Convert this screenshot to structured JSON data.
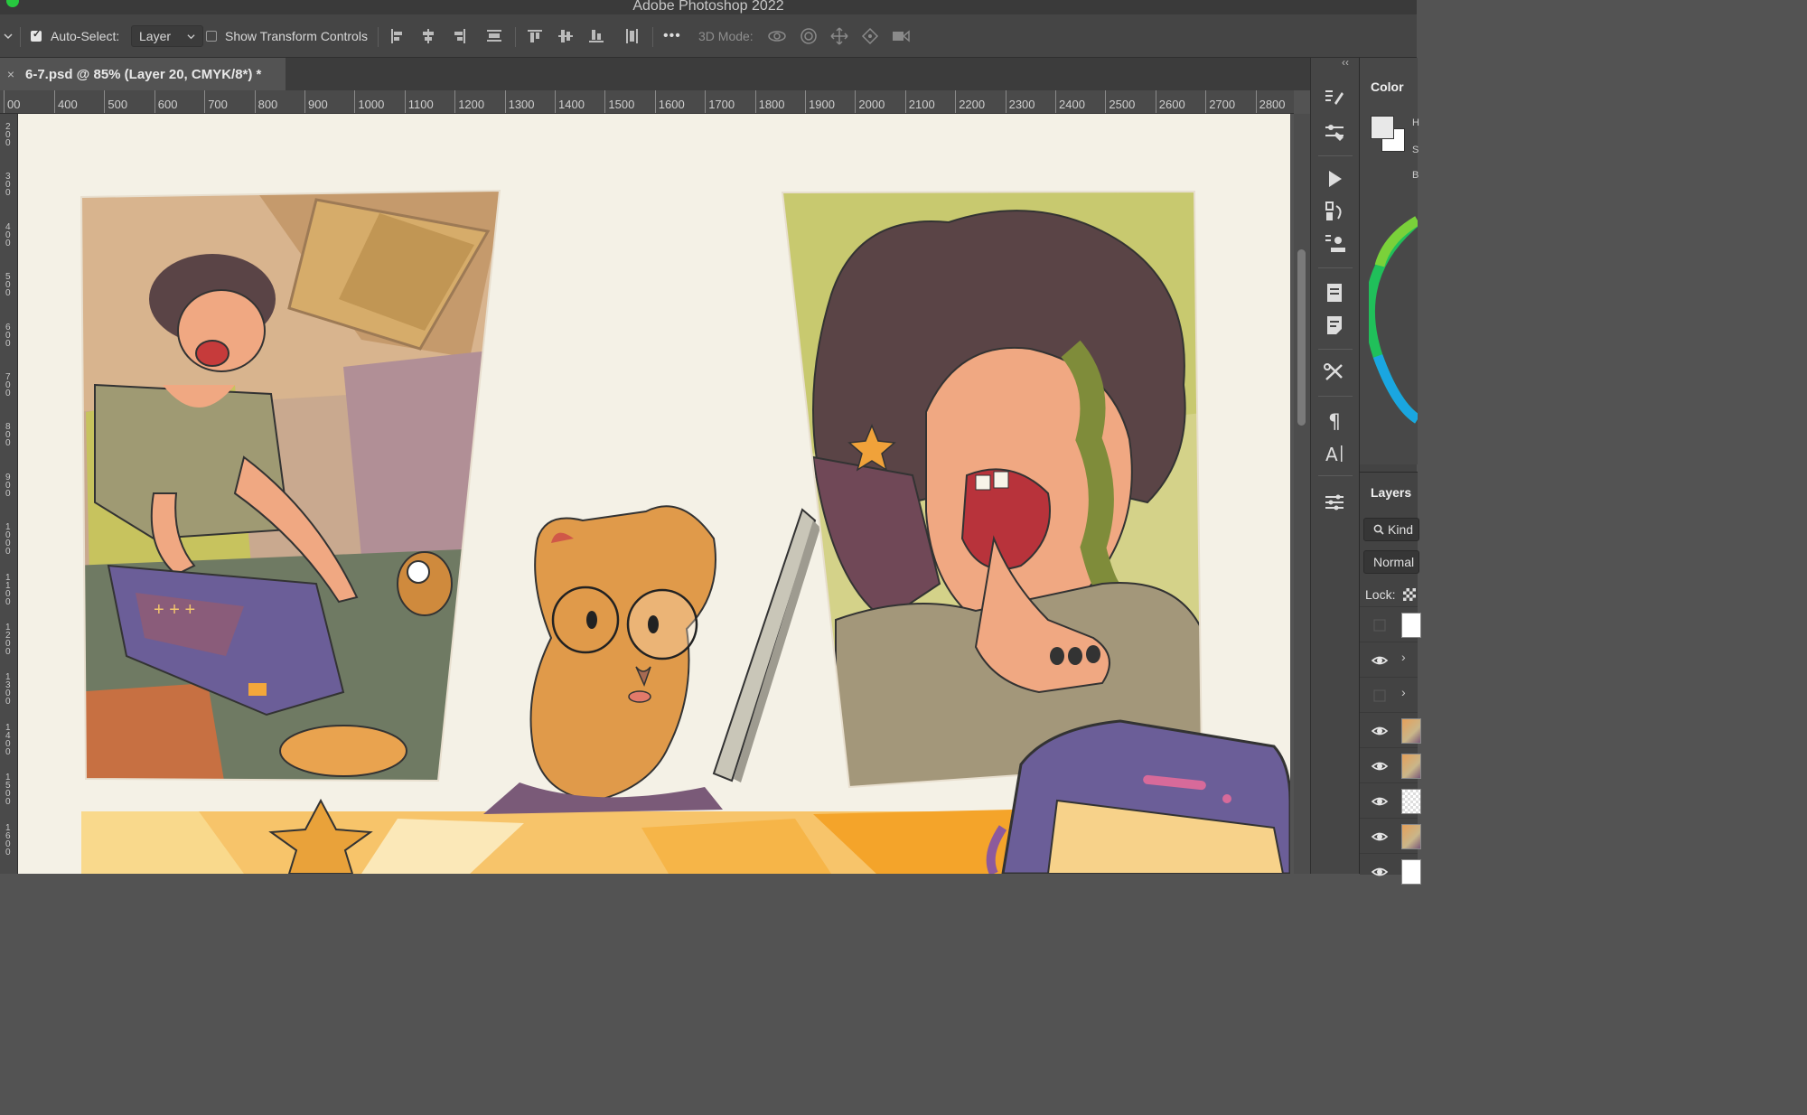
{
  "app": {
    "title": "Adobe Photoshop 2022"
  },
  "options_bar": {
    "auto_select_label": "Auto-Select:",
    "auto_select_checked": true,
    "auto_select_target": "Layer",
    "show_transform_label": "Show Transform Controls",
    "show_transform_checked": false,
    "more_label": "•••",
    "mode_3d_label": "3D Mode:"
  },
  "document": {
    "tab_title": "6-7.psd @ 85% (Layer 20, CMYK/8*) *",
    "close_label": "×"
  },
  "ruler": {
    "horizontal": [
      "00",
      "400",
      "500",
      "600",
      "700",
      "800",
      "900",
      "1000",
      "1100",
      "1200",
      "1300",
      "1400",
      "1500",
      "1600",
      "1700",
      "1800",
      "1900",
      "2000",
      "2100",
      "2200",
      "2300",
      "2400",
      "2500",
      "2600",
      "2700",
      "2800"
    ],
    "vertical": [
      "200",
      "300",
      "400",
      "500",
      "600",
      "700",
      "800",
      "900",
      "1000",
      "1100",
      "1200",
      "1300",
      "1400",
      "1500",
      "1600"
    ]
  },
  "tools_right": [
    "brush-preset-icon",
    "adjust-sliders-icon",
    "play-actions-icon",
    "clone-source-icon",
    "stamp-icon",
    "notes-panel-icon",
    "paragraph-styles-icon",
    "tool-presets-icon",
    "paragraph-icon",
    "character-icon",
    "properties-icon"
  ],
  "panels": {
    "color_title": "Color",
    "color_letters": [
      "H",
      "S",
      "B"
    ],
    "layers_title": "Layers",
    "kind_label": "Kind",
    "blend_mode": "Normal",
    "lock_label": "Lock:",
    "layer_rows": [
      {
        "visible": false,
        "type": "white"
      },
      {
        "visible": true,
        "type": "group"
      },
      {
        "visible": false,
        "type": "group"
      },
      {
        "visible": true,
        "type": "art"
      },
      {
        "visible": true,
        "type": "art"
      },
      {
        "visible": true,
        "type": "transparent"
      },
      {
        "visible": true,
        "type": "art"
      },
      {
        "visible": true,
        "type": "white"
      }
    ]
  },
  "colors": {
    "workspace": "#535353",
    "paper": "#f4f1e6",
    "panel_bg": "#434343"
  }
}
